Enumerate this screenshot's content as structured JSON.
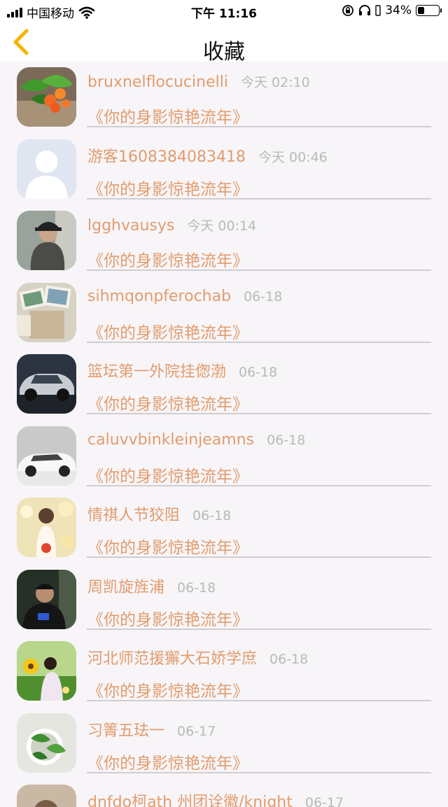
{
  "status": {
    "carrier": "中国移动",
    "time": "下午 11:16",
    "battery": "34%",
    "battery_level": 0.34
  },
  "nav": {
    "title": "收藏",
    "back_icon": "chevron-left-icon",
    "accent": "#f5b400"
  },
  "items": [
    {
      "user": "bruxnelflocucinelli",
      "time": "今天 02:10",
      "book": "《你的身影惊艳流年》"
    },
    {
      "user": "游客1608384083418",
      "time": "今天 00:46",
      "book": "《你的身影惊艳流年》"
    },
    {
      "user": "lgghvausys",
      "time": "今天 00:14",
      "book": "《你的身影惊艳流年》"
    },
    {
      "user": "sihmqonpferochab",
      "time": "06-18",
      "book": "《你的身影惊艳流年》"
    },
    {
      "user": "篮坛第一外院挂偬渤",
      "time": "06-18",
      "book": "《你的身影惊艳流年》"
    },
    {
      "user": "caluvvbinkleinjeamns",
      "time": "06-18",
      "book": "《你的身影惊艳流年》"
    },
    {
      "user": "情祺人节狡阻",
      "time": "06-18",
      "book": "《你的身影惊艳流年》"
    },
    {
      "user": "周凯旋旌浦",
      "time": "06-18",
      "book": "《你的身影惊艳流年》"
    },
    {
      "user": "河北师范援獬大石娇学庶",
      "time": "06-18",
      "book": "《你的身影惊艳流年》"
    },
    {
      "user": "习箐五珐一",
      "time": "06-17",
      "book": "《你的身影惊艳流年》"
    },
    {
      "user": "dnfdo柯ath 州团诠徽/knight",
      "time": "06-17",
      "book": ""
    }
  ],
  "colors": {
    "name": "#e29c6c",
    "time": "#b9b9b9",
    "background": "#f7f5f8"
  }
}
